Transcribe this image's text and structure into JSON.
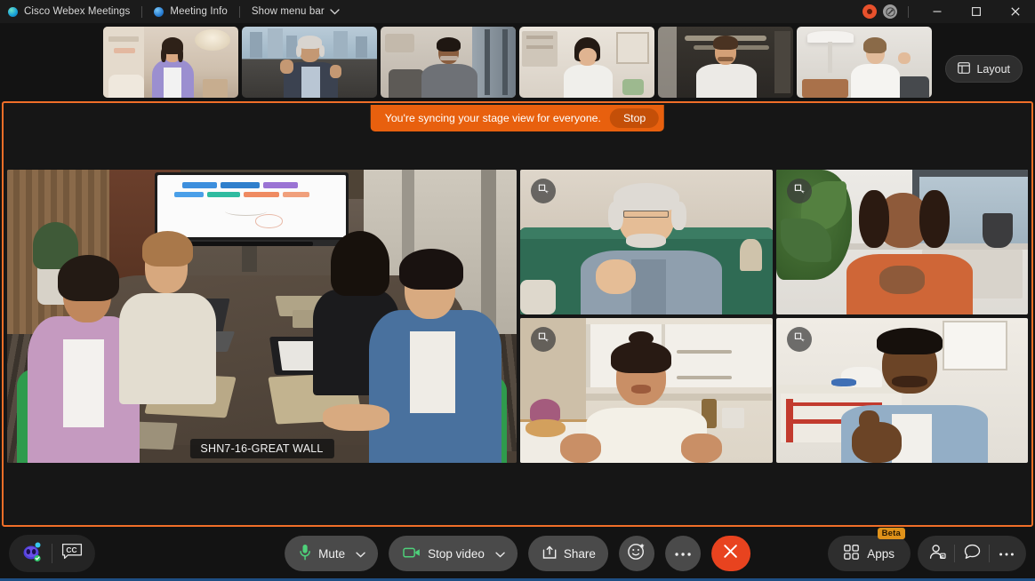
{
  "window": {
    "app_title": "Cisco Webex Meetings",
    "meeting_info_label": "Meeting Info",
    "show_menu_bar_label": "Show menu bar",
    "icons": {
      "app_dot": "webex-logo-icon",
      "meeting_info_dot": "info-dot-icon",
      "menu_chevron": "chevron-down-icon",
      "record": "record-icon",
      "network": "network-status-icon",
      "minimize": "minimize-icon",
      "maximize": "maximize-icon",
      "close": "close-icon"
    }
  },
  "filmstrip": {
    "thumbnails": [
      {
        "name": "participant-thumb-1",
        "alt": "Woman in purple jacket in living room"
      },
      {
        "name": "participant-thumb-2",
        "alt": "Older man waving, city skyline background"
      },
      {
        "name": "participant-thumb-3",
        "alt": "Man in grey sweater in office"
      },
      {
        "name": "participant-thumb-4",
        "alt": "Woman in white blouse at home desk"
      },
      {
        "name": "participant-thumb-5",
        "alt": "Man in white shirt in dark office"
      },
      {
        "name": "participant-thumb-6",
        "alt": "Woman waving near a floor lamp"
      }
    ],
    "layout_button": {
      "label": "Layout",
      "icon": "layout-grid-icon"
    }
  },
  "stage": {
    "border_color": "#f06e28",
    "banner": {
      "message": "You're syncing your stage view for everyone.",
      "stop_label": "Stop",
      "background": "#e8600e"
    },
    "main_video": {
      "nameplate": "SHN7-16-GREAT WALL",
      "alt": "Conference room with five people around a table and a shared whiteboard screen"
    },
    "tiles": [
      {
        "name": "video-tile-1",
        "pin_icon": "pin-to-stage-icon",
        "alt": "Smiling older man with white beard on green sofa"
      },
      {
        "name": "video-tile-2",
        "pin_icon": "pin-to-stage-icon",
        "alt": "Woman in orange top in front of plant and window"
      },
      {
        "name": "video-tile-3",
        "pin_icon": "pin-to-stage-icon",
        "alt": "Woman in cream blouse talking in kitchen"
      },
      {
        "name": "video-tile-4",
        "pin_icon": "pin-to-stage-icon",
        "alt": "Man in denim shirt giving thumbs up"
      }
    ]
  },
  "toolbar": {
    "assistant": {
      "name": "ai-assistant-button",
      "icon": "webex-ai-assistant-icon"
    },
    "captions": {
      "name": "closed-captions-button",
      "icon": "cc-icon"
    },
    "mute": {
      "label": "Mute",
      "icon": "microphone-icon",
      "caret": "chevron-down-icon"
    },
    "video": {
      "label": "Stop video",
      "icon": "camera-icon",
      "caret": "chevron-down-icon"
    },
    "share": {
      "label": "Share",
      "icon": "share-screen-icon"
    },
    "reactions": {
      "icon": "smiley-reaction-icon"
    },
    "more": {
      "icon": "ellipsis-icon"
    },
    "end_call": {
      "icon": "end-call-x-icon",
      "color": "#e8431f"
    },
    "apps": {
      "label": "Apps",
      "icon": "apps-grid-icon",
      "badge": "Beta",
      "badge_color": "#e0921a"
    },
    "participants": {
      "icon": "participants-icon"
    },
    "chat": {
      "icon": "chat-bubble-icon"
    },
    "more_options": {
      "icon": "ellipsis-icon"
    }
  },
  "colors": {
    "window_bg": "#131313",
    "titlebar_bg": "#1b1b1b",
    "accent_orange": "#f06e28",
    "bottom_accent": "#1e4f84",
    "mic_green": "#4ed17a"
  }
}
